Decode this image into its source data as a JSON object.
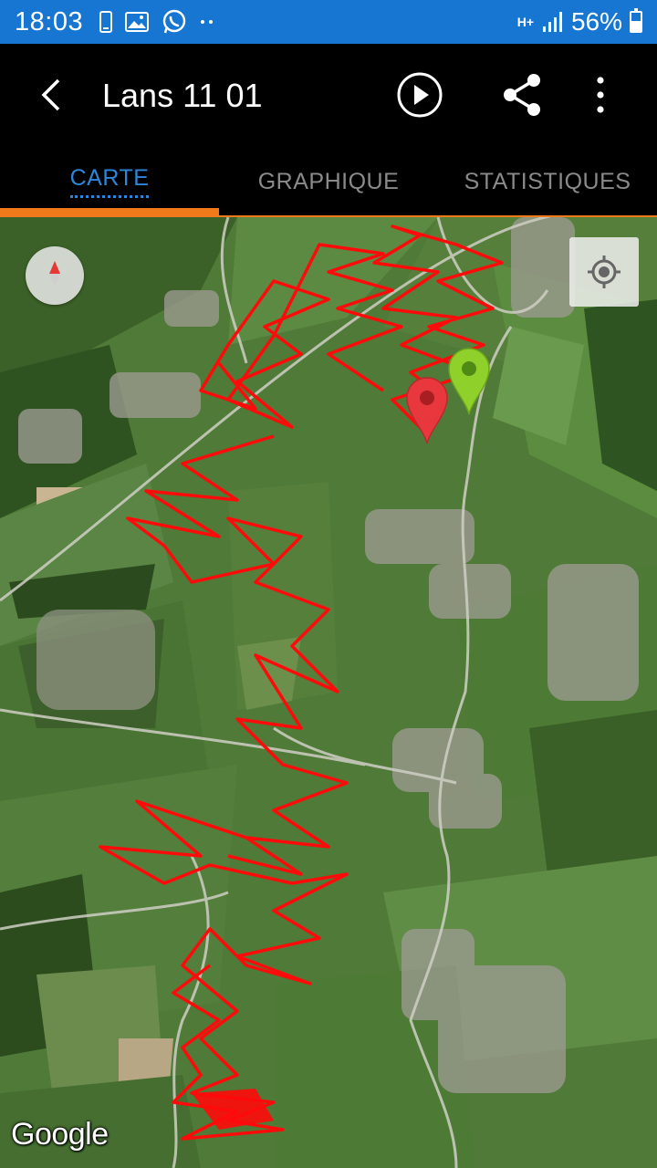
{
  "status_bar": {
    "time": "18:03",
    "network": "H+",
    "battery": "56%",
    "battery_level": 0.56,
    "icons": [
      "phone-icon",
      "gallery-icon",
      "whatsapp-icon",
      "more-notifications-icon",
      "signal-icon",
      "battery-icon"
    ]
  },
  "app_bar": {
    "title": "Lans 11 01",
    "icons": [
      "back-arrow-icon",
      "play-icon",
      "share-icon",
      "more-vert-icon"
    ]
  },
  "tabs": [
    {
      "label": "CARTE",
      "active": true
    },
    {
      "label": "GRAPHIQUE",
      "active": false
    },
    {
      "label": "STATISTIQUES",
      "active": false
    }
  ],
  "map": {
    "attribution": "Google",
    "map_type": "satellite",
    "track_color": "#ff0a0a",
    "start_marker_color": "#8fd12a",
    "end_marker_color": "#e8383d",
    "controls": [
      "compass-icon",
      "my-location-icon"
    ]
  },
  "colors": {
    "status_bar": "#1676d2",
    "app_bar": "#000000",
    "tab_active": "#2f86d8",
    "tab_inactive": "#8a8a8a",
    "tab_indicator": "#f07a1a"
  }
}
